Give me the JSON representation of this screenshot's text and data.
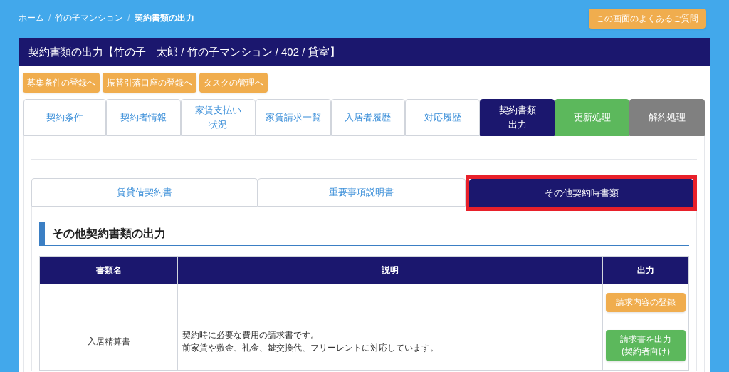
{
  "breadcrumb": [
    {
      "label": "ホーム",
      "current": false
    },
    {
      "separator": "/",
      "label": "竹の子マンション",
      "current": false
    },
    {
      "separator": "/",
      "label": "契約書類の出力",
      "current": true
    }
  ],
  "faq_button": "この画面のよくあるご質問",
  "panel": {
    "title": "契約書類の出力【竹の子　太郎 / 竹の子マンション / 402 / 貸室】",
    "link_buttons": [
      "募集条件の登録へ",
      "振替引落口座の登録へ",
      "タスクの管理へ"
    ],
    "tabs": [
      {
        "label": "契約条件",
        "kind": "normal",
        "selected": false
      },
      {
        "label": "契約者情報",
        "kind": "normal",
        "selected": false
      },
      {
        "label": [
          "家賃支払い",
          "状況"
        ],
        "kind": "normal",
        "selected": false
      },
      {
        "label": "家賃請求一覧",
        "kind": "normal",
        "selected": false
      },
      {
        "label": "入居者履歴",
        "kind": "normal",
        "selected": false
      },
      {
        "label": "対応履歴",
        "kind": "normal",
        "selected": false
      },
      {
        "label": [
          "契約書類",
          "出力"
        ],
        "kind": "normal",
        "selected": true
      },
      {
        "label": "更新処理",
        "kind": "renew",
        "selected": false
      },
      {
        "label": "解約処理",
        "kind": "cancel",
        "selected": false
      }
    ],
    "sub_tabs": [
      {
        "label": "賃貸借契約書",
        "selected": false,
        "highlighted": false
      },
      {
        "label": "重要事項説明書",
        "selected": false,
        "highlighted": false
      },
      {
        "label": "その他契約時書類",
        "selected": true,
        "highlighted": true
      }
    ],
    "section_heading": "その他契約書類の出力",
    "table": {
      "columns": [
        "書類名",
        "説明",
        "出力"
      ],
      "rows": [
        {
          "name": "入居精算書",
          "description": [
            "契約時に必要な費用の請求書です。",
            "前家賃や敷金、礼金、鍵交換代、フリーレントに対応しています。"
          ],
          "actions": [
            {
              "label": "請求内容の登録",
              "kind": "warning"
            },
            {
              "label": [
                "請求書を出力",
                "(契約者向け)"
              ],
              "kind": "success"
            }
          ]
        }
      ]
    }
  }
}
